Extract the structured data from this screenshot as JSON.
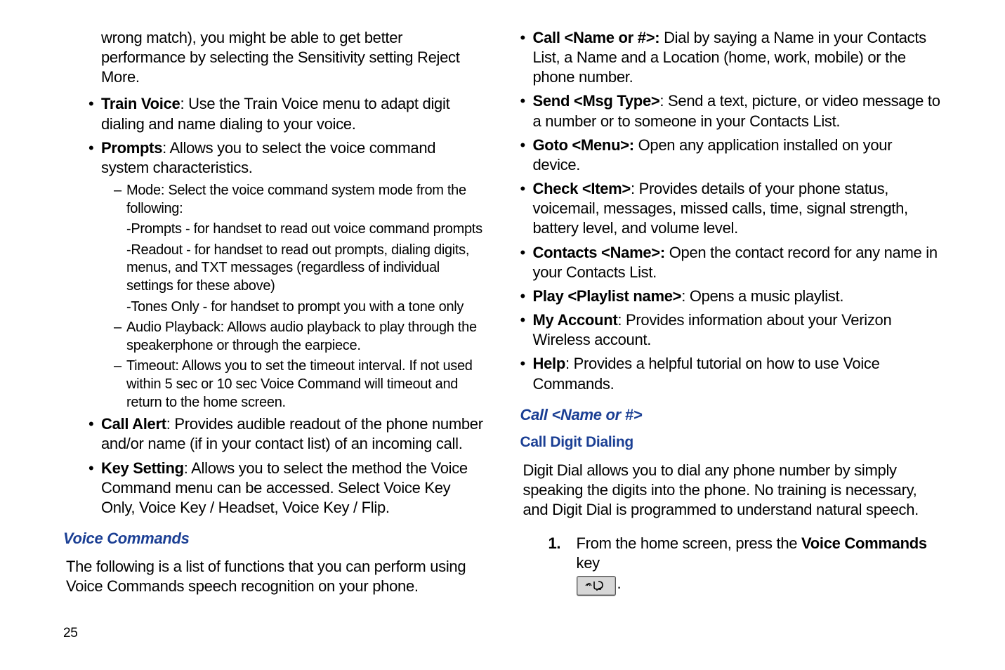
{
  "page_number": "25",
  "left": {
    "top_cont": "wrong match), you might be able to get better performance by selecting the Sensitivity setting Reject More.",
    "train_voice_b": "Train Voice",
    "train_voice_t": ": Use the Train Voice menu to adapt digit dialing and name dialing to your voice.",
    "prompts_b": "Prompts",
    "prompts_t": ": Allows you to select the voice command system characteristics.",
    "mode_t": "Mode: Select the voice command system mode from the following:",
    "mode_a": "-Prompts - for handset to read out voice command prompts",
    "mode_b": "-Readout - for handset to read out prompts, dialing digits, menus, and TXT messages (regardless of individual settings for these above)",
    "mode_c": "-Tones Only - for handset to prompt you with a tone only",
    "audio_t": "Audio Playback: Allows audio playback to play through the speakerphone or through the earpiece.",
    "timeout_t": "Timeout: Allows you to set the timeout interval. If not used within 5 sec or 10 sec Voice Command will timeout and return to the home screen.",
    "call_alert_b": "Call Alert",
    "call_alert_t": ": Provides audible readout of the phone number and/or name (if in your contact list) of an incoming call.",
    "key_setting_b": "Key Setting",
    "key_setting_t": ": Allows you to select the method the Voice Command menu can be accessed. Select Voice Key Only, Voice Key / Headset, Voice Key / Flip.",
    "voice_commands_h": "Voice Commands",
    "voice_commands_body": "The following is a list of functions that you can perform using Voice Commands speech recognition on your phone."
  },
  "right": {
    "call_b": "Call <Name or #>:",
    "call_t": " Dial by saying a Name in your Contacts List, a Name and a Location (home, work, mobile) or the phone number.",
    "send_b": "Send <Msg Type>",
    "send_t": ": Send a text, picture, or video message to a number or to someone in your Contacts List.",
    "goto_b": "Goto <Menu>:",
    "goto_t": " Open any application installed on your device.",
    "check_b": "Check <Item>",
    "check_t": ": Provides details of your phone status, voicemail, messages, missed calls, time, signal strength, battery level, and volume level.",
    "contacts_b": "Contacts <Name>:",
    "contacts_t": " Open the contact record for any name in your Contacts List.",
    "play_b": "Play <Playlist name>",
    "play_t": ": Opens a music playlist.",
    "myacct_b": "My Account",
    "myacct_t": ": Provides information about your Verizon Wireless account.",
    "help_b": "Help",
    "help_t": ": Provides a helpful tutorial on how to use Voice Commands.",
    "h_call": "Call <Name or #>",
    "h_digit": "Call Digit Dialing",
    "digit_body": "Digit Dial allows you to dial any phone number by simply speaking the digits into the phone. No training is necessary, and Digit Dial is programmed to understand natural speech.",
    "step1_num": "1.",
    "step1_a": "From the home screen, press the ",
    "step1_b": "Voice Commands",
    "step1_c": " key",
    "step1_d": "."
  }
}
